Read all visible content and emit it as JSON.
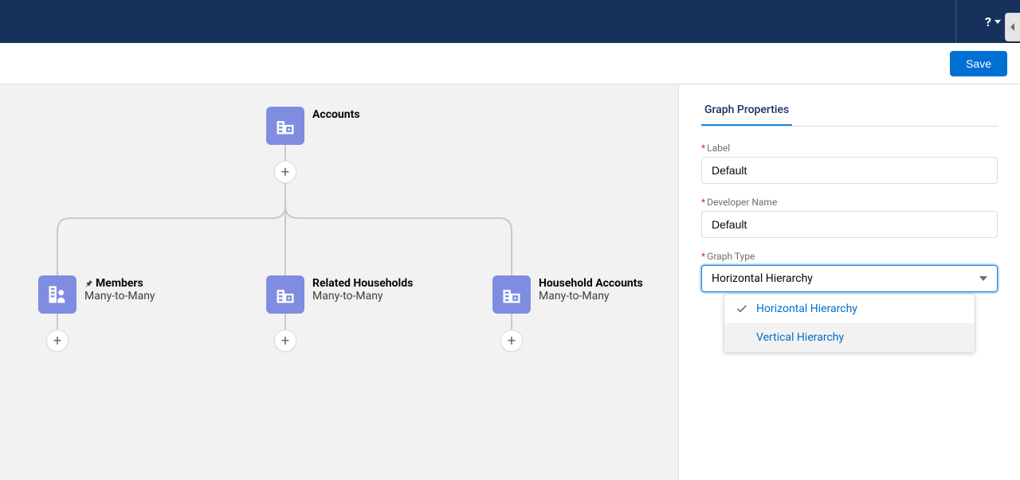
{
  "header": {
    "help_label": "?"
  },
  "toolbar": {
    "save_label": "Save"
  },
  "graph": {
    "root": {
      "title": "Accounts"
    },
    "children": [
      {
        "title": "Members",
        "subtitle": "Many-to-Many",
        "pinned": true
      },
      {
        "title": "Related Households",
        "subtitle": "Many-to-Many",
        "pinned": false
      },
      {
        "title": "Household Accounts",
        "subtitle": "Many-to-Many",
        "pinned": false
      }
    ]
  },
  "panel": {
    "tab_label": "Graph Properties",
    "fields": {
      "label": {
        "label": "Label",
        "value": "Default"
      },
      "developer_name": {
        "label": "Developer Name",
        "value": "Default"
      },
      "graph_type": {
        "label": "Graph Type",
        "value": "Horizontal Hierarchy",
        "options": [
          "Horizontal Hierarchy",
          "Vertical Hierarchy"
        ]
      }
    }
  }
}
